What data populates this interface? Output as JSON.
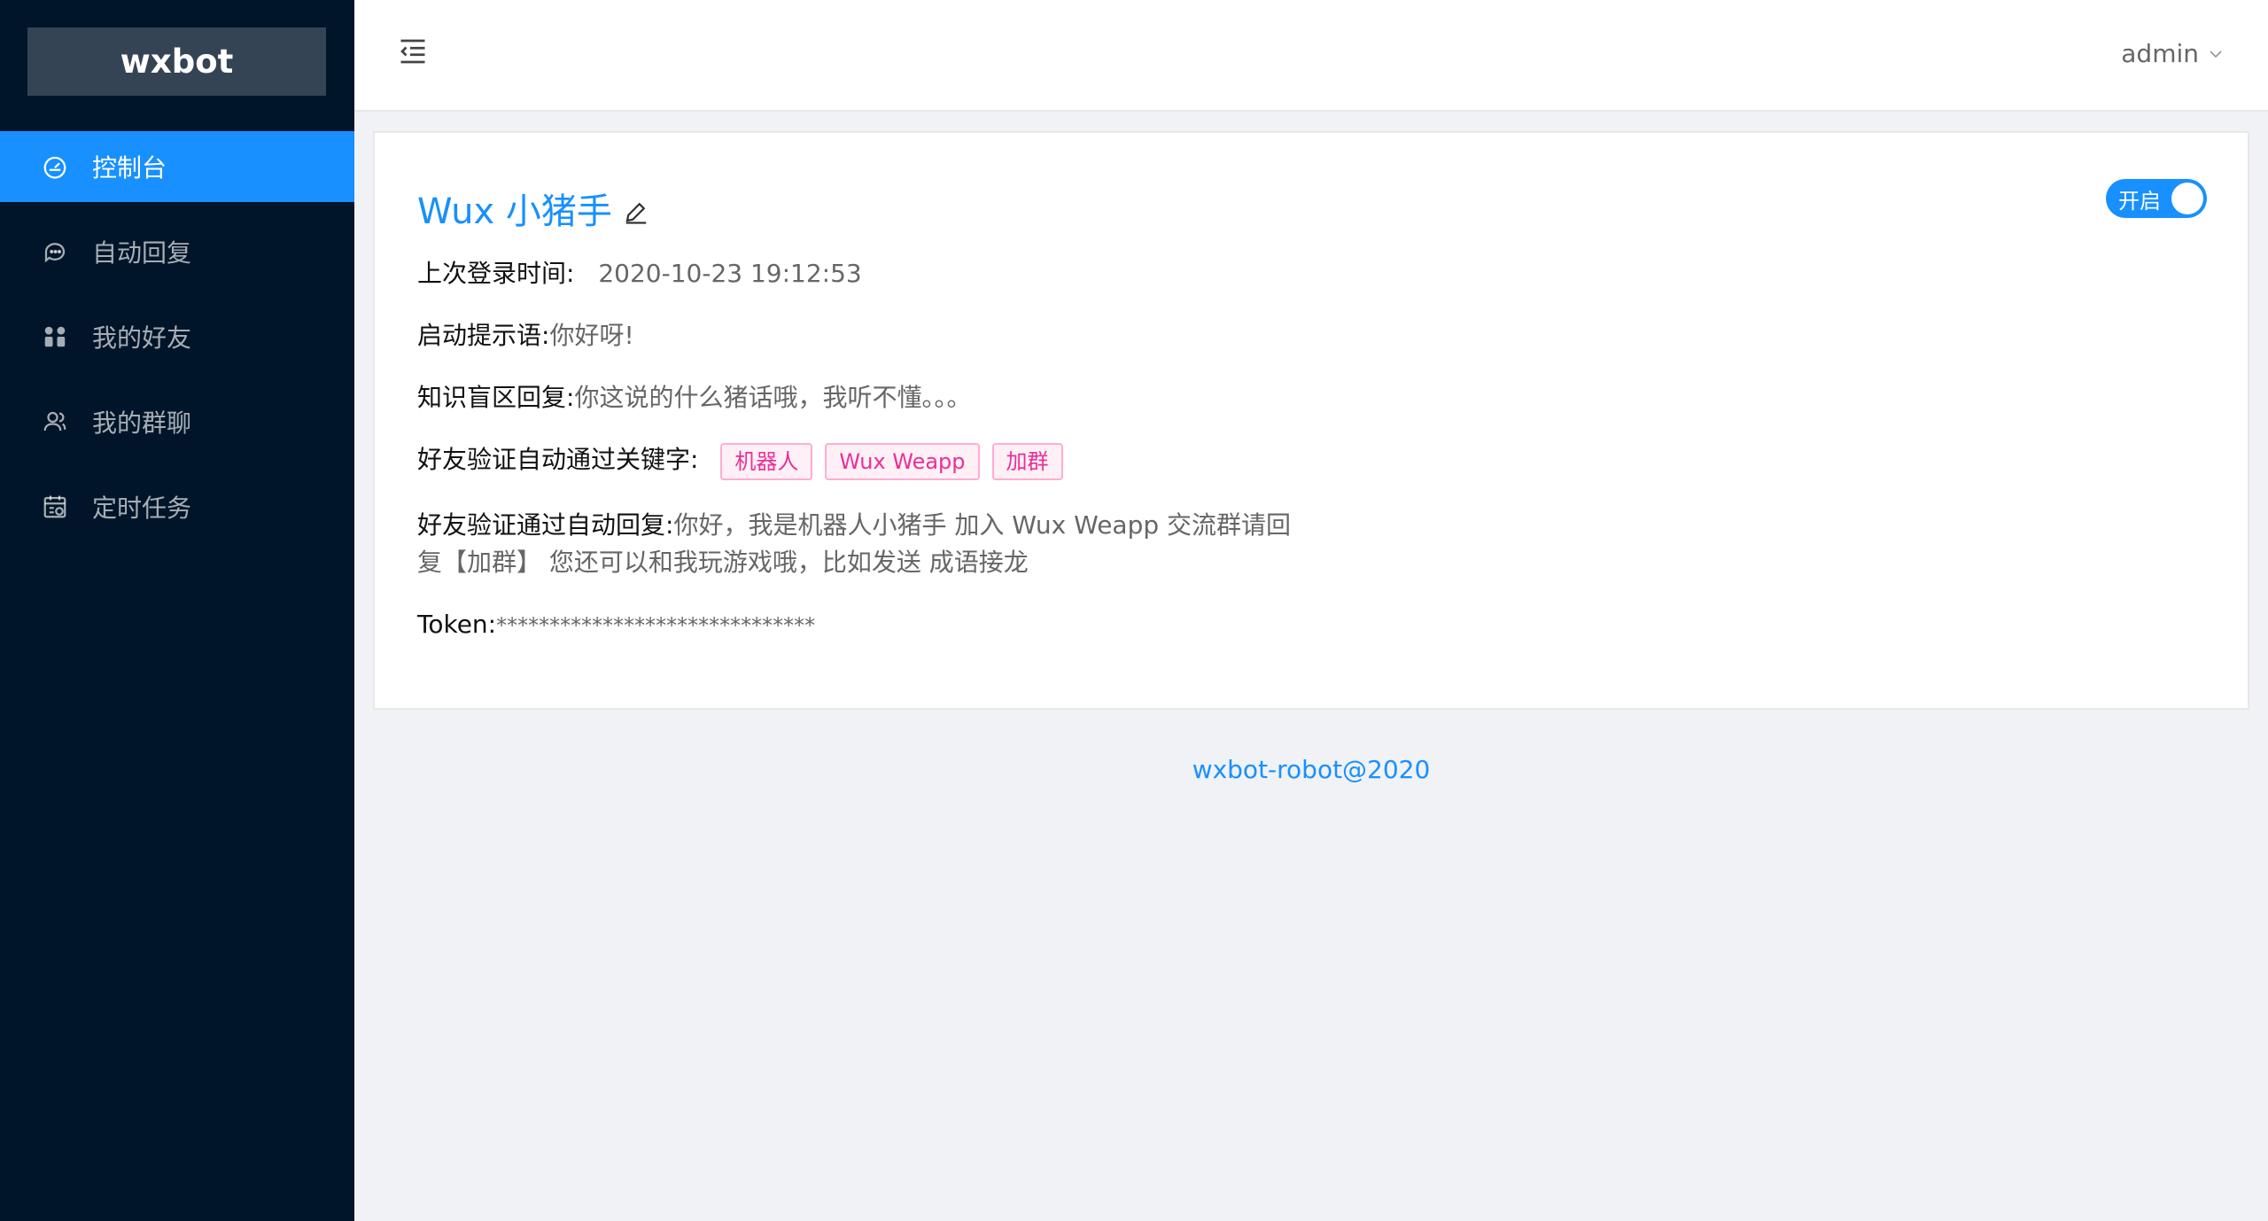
{
  "app": {
    "logo": "wxbot"
  },
  "sidebar": {
    "items": [
      {
        "label": "控制台",
        "icon": "dashboard-icon",
        "active": true
      },
      {
        "label": "自动回复",
        "icon": "message-icon",
        "active": false
      },
      {
        "label": "我的好友",
        "icon": "appstore-icon",
        "active": false
      },
      {
        "label": "我的群聊",
        "icon": "team-icon",
        "active": false
      },
      {
        "label": "定时任务",
        "icon": "schedule-icon",
        "active": false
      }
    ]
  },
  "header": {
    "user": "admin"
  },
  "card": {
    "title": "Wux 小猪手",
    "switch_label": "开启",
    "switch_on": true,
    "last_login_label": "上次登录时间:",
    "last_login_value": "2020-10-23 19:12:53",
    "greeting_label": "启动提示语:",
    "greeting_value": "你好呀!",
    "unknown_label": "知识盲区回复:",
    "unknown_value": "你这说的什么猪话哦，我听不懂。。。",
    "keywords_label": "好友验证自动通过关键字:",
    "keywords": [
      "机器人",
      "Wux Weapp",
      "加群"
    ],
    "auto_reply_label": "好友验证通过自动回复:",
    "auto_reply_value": "你好，我是机器人小猪手 加入 Wux Weapp 交流群请回复【加群】 您还可以和我玩游戏哦，比如发送 成语接龙",
    "token_label": "Token:",
    "token_value": "******************************"
  },
  "footer": {
    "text": "wxbot-robot@2020"
  },
  "colors": {
    "primary": "#1890ff",
    "sidebar": "#001529",
    "tag": "#eb2f96"
  }
}
